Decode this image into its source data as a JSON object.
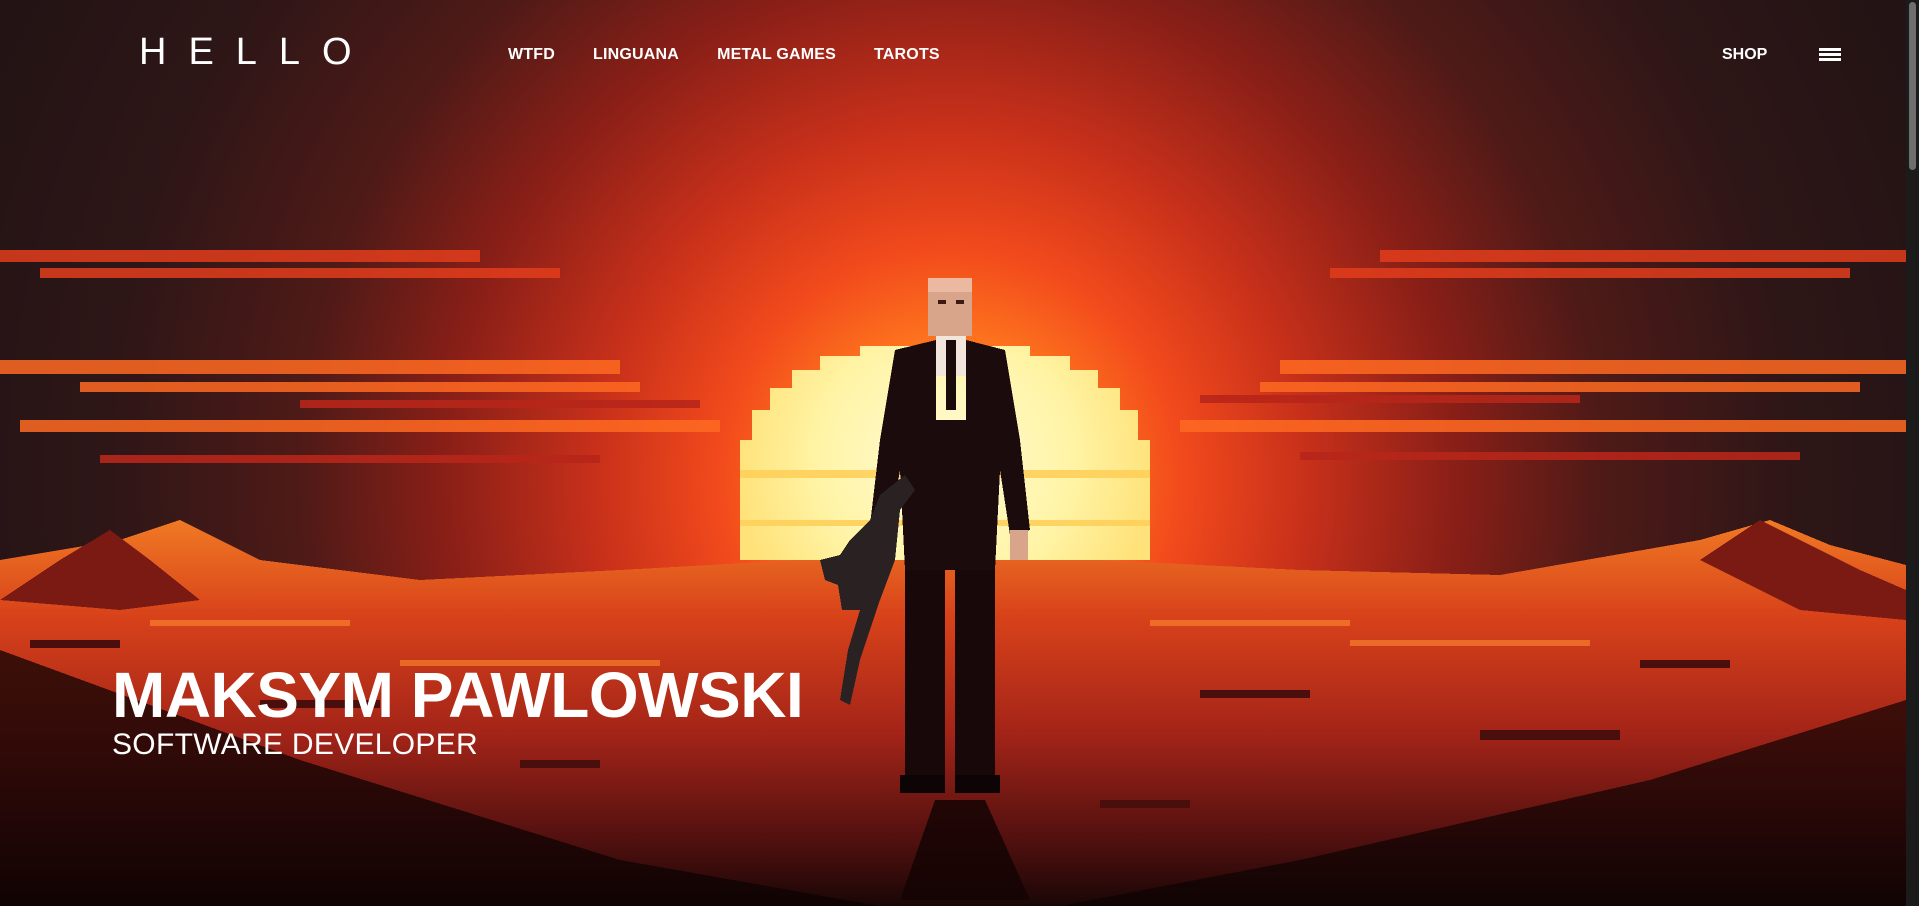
{
  "header": {
    "logo": "HELLO",
    "nav": [
      "WTFD",
      "LINGUANA",
      "METAL GAMES",
      "TAROTS"
    ],
    "shop_label": "SHOP"
  },
  "hero": {
    "name": "MAKSYM PAWLOWSKI",
    "role": "SOFTWARE DEVELOPER",
    "image_icon": "pixel-art-hitman-sunset"
  },
  "colors": {
    "sky_dark": "#2b1516",
    "sky_red": "#a4261b",
    "sun": "#fff3a0",
    "desert_orange": "#e2451f",
    "text": "#ffffff"
  }
}
